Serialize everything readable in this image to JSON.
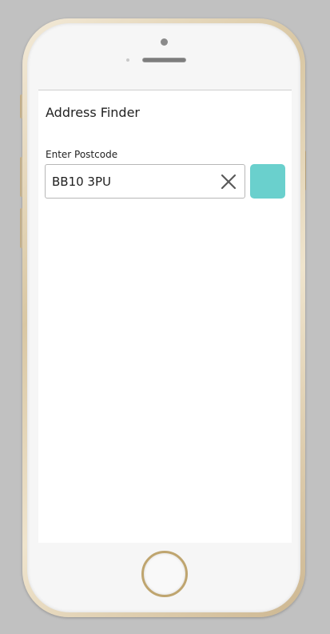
{
  "app": {
    "title": "Address Finder"
  },
  "form": {
    "label": "Enter Postcode",
    "postcode_value": "BB10 3PU"
  },
  "icons": {
    "clear": "close-icon",
    "search_button": "search-button"
  },
  "colors": {
    "accent": "#6ad0cd",
    "background": "#c1c1c1",
    "frame_gold": "#d9c7a3"
  }
}
